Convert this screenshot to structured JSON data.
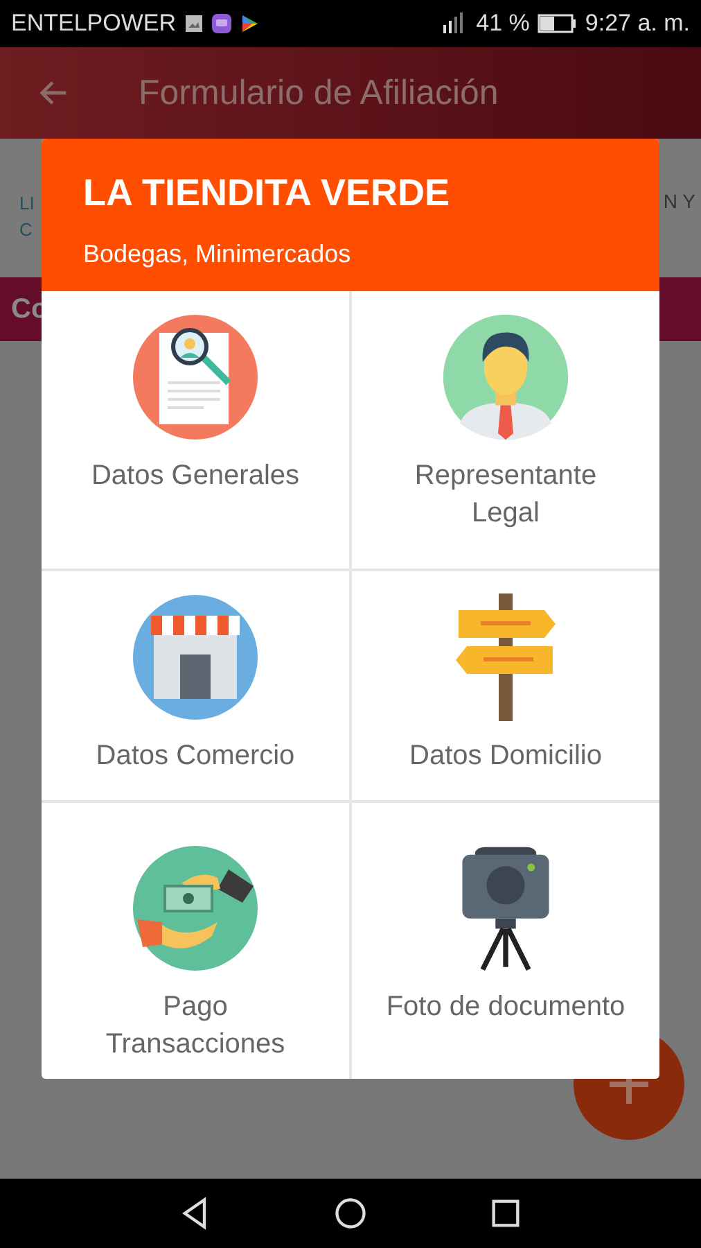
{
  "status_bar": {
    "carrier": "ENTELPOWER",
    "battery": "41 %",
    "time": "9:27 a. m."
  },
  "app_bar": {
    "title": "Formulario de Afiliación"
  },
  "background_tabs": {
    "left_lines": [
      "LI",
      "C"
    ],
    "right_text": "N Y"
  },
  "section_header": {
    "text": "Co"
  },
  "dialog": {
    "title": "LA TIENDITA VERDE",
    "subtitle": "Bodegas, Minimercados",
    "options": [
      {
        "label": "Datos Generales",
        "kind": "document"
      },
      {
        "label": "Representante Legal",
        "kind": "person"
      },
      {
        "label": "Datos Comercio",
        "kind": "store"
      },
      {
        "label": "Datos Domicilio",
        "kind": "signpost"
      },
      {
        "label": "Pago Transacciones",
        "kind": "payment"
      },
      {
        "label": "Foto de documento",
        "kind": "camera"
      }
    ]
  }
}
